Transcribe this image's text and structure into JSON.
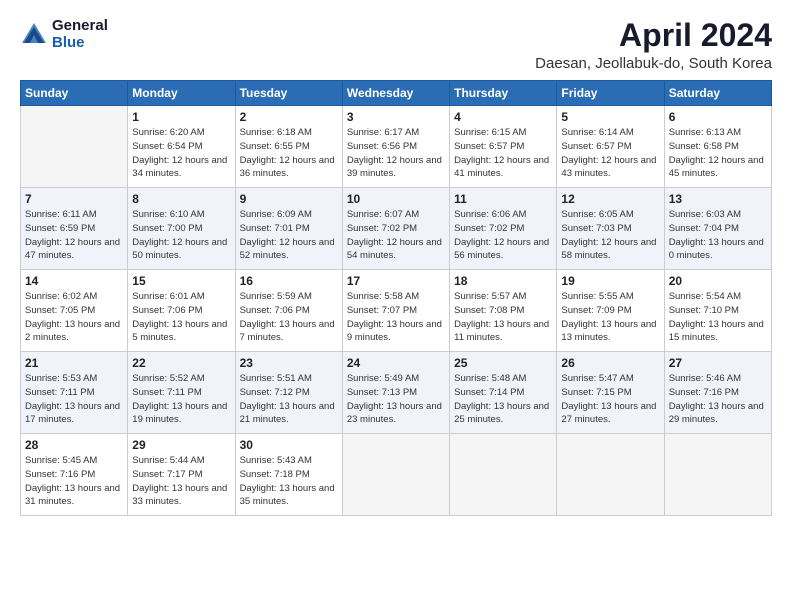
{
  "header": {
    "logo": {
      "general": "General",
      "blue": "Blue"
    },
    "title": "April 2024",
    "location": "Daesan, Jeollabuk-do, South Korea"
  },
  "days_of_week": [
    "Sunday",
    "Monday",
    "Tuesday",
    "Wednesday",
    "Thursday",
    "Friday",
    "Saturday"
  ],
  "weeks": [
    [
      {
        "day": "",
        "sunrise": "",
        "sunset": "",
        "daylight": ""
      },
      {
        "day": "1",
        "sunrise": "Sunrise: 6:20 AM",
        "sunset": "Sunset: 6:54 PM",
        "daylight": "Daylight: 12 hours and 34 minutes."
      },
      {
        "day": "2",
        "sunrise": "Sunrise: 6:18 AM",
        "sunset": "Sunset: 6:55 PM",
        "daylight": "Daylight: 12 hours and 36 minutes."
      },
      {
        "day": "3",
        "sunrise": "Sunrise: 6:17 AM",
        "sunset": "Sunset: 6:56 PM",
        "daylight": "Daylight: 12 hours and 39 minutes."
      },
      {
        "day": "4",
        "sunrise": "Sunrise: 6:15 AM",
        "sunset": "Sunset: 6:57 PM",
        "daylight": "Daylight: 12 hours and 41 minutes."
      },
      {
        "day": "5",
        "sunrise": "Sunrise: 6:14 AM",
        "sunset": "Sunset: 6:57 PM",
        "daylight": "Daylight: 12 hours and 43 minutes."
      },
      {
        "day": "6",
        "sunrise": "Sunrise: 6:13 AM",
        "sunset": "Sunset: 6:58 PM",
        "daylight": "Daylight: 12 hours and 45 minutes."
      }
    ],
    [
      {
        "day": "7",
        "sunrise": "Sunrise: 6:11 AM",
        "sunset": "Sunset: 6:59 PM",
        "daylight": "Daylight: 12 hours and 47 minutes."
      },
      {
        "day": "8",
        "sunrise": "Sunrise: 6:10 AM",
        "sunset": "Sunset: 7:00 PM",
        "daylight": "Daylight: 12 hours and 50 minutes."
      },
      {
        "day": "9",
        "sunrise": "Sunrise: 6:09 AM",
        "sunset": "Sunset: 7:01 PM",
        "daylight": "Daylight: 12 hours and 52 minutes."
      },
      {
        "day": "10",
        "sunrise": "Sunrise: 6:07 AM",
        "sunset": "Sunset: 7:02 PM",
        "daylight": "Daylight: 12 hours and 54 minutes."
      },
      {
        "day": "11",
        "sunrise": "Sunrise: 6:06 AM",
        "sunset": "Sunset: 7:02 PM",
        "daylight": "Daylight: 12 hours and 56 minutes."
      },
      {
        "day": "12",
        "sunrise": "Sunrise: 6:05 AM",
        "sunset": "Sunset: 7:03 PM",
        "daylight": "Daylight: 12 hours and 58 minutes."
      },
      {
        "day": "13",
        "sunrise": "Sunrise: 6:03 AM",
        "sunset": "Sunset: 7:04 PM",
        "daylight": "Daylight: 13 hours and 0 minutes."
      }
    ],
    [
      {
        "day": "14",
        "sunrise": "Sunrise: 6:02 AM",
        "sunset": "Sunset: 7:05 PM",
        "daylight": "Daylight: 13 hours and 2 minutes."
      },
      {
        "day": "15",
        "sunrise": "Sunrise: 6:01 AM",
        "sunset": "Sunset: 7:06 PM",
        "daylight": "Daylight: 13 hours and 5 minutes."
      },
      {
        "day": "16",
        "sunrise": "Sunrise: 5:59 AM",
        "sunset": "Sunset: 7:06 PM",
        "daylight": "Daylight: 13 hours and 7 minutes."
      },
      {
        "day": "17",
        "sunrise": "Sunrise: 5:58 AM",
        "sunset": "Sunset: 7:07 PM",
        "daylight": "Daylight: 13 hours and 9 minutes."
      },
      {
        "day": "18",
        "sunrise": "Sunrise: 5:57 AM",
        "sunset": "Sunset: 7:08 PM",
        "daylight": "Daylight: 13 hours and 11 minutes."
      },
      {
        "day": "19",
        "sunrise": "Sunrise: 5:55 AM",
        "sunset": "Sunset: 7:09 PM",
        "daylight": "Daylight: 13 hours and 13 minutes."
      },
      {
        "day": "20",
        "sunrise": "Sunrise: 5:54 AM",
        "sunset": "Sunset: 7:10 PM",
        "daylight": "Daylight: 13 hours and 15 minutes."
      }
    ],
    [
      {
        "day": "21",
        "sunrise": "Sunrise: 5:53 AM",
        "sunset": "Sunset: 7:11 PM",
        "daylight": "Daylight: 13 hours and 17 minutes."
      },
      {
        "day": "22",
        "sunrise": "Sunrise: 5:52 AM",
        "sunset": "Sunset: 7:11 PM",
        "daylight": "Daylight: 13 hours and 19 minutes."
      },
      {
        "day": "23",
        "sunrise": "Sunrise: 5:51 AM",
        "sunset": "Sunset: 7:12 PM",
        "daylight": "Daylight: 13 hours and 21 minutes."
      },
      {
        "day": "24",
        "sunrise": "Sunrise: 5:49 AM",
        "sunset": "Sunset: 7:13 PM",
        "daylight": "Daylight: 13 hours and 23 minutes."
      },
      {
        "day": "25",
        "sunrise": "Sunrise: 5:48 AM",
        "sunset": "Sunset: 7:14 PM",
        "daylight": "Daylight: 13 hours and 25 minutes."
      },
      {
        "day": "26",
        "sunrise": "Sunrise: 5:47 AM",
        "sunset": "Sunset: 7:15 PM",
        "daylight": "Daylight: 13 hours and 27 minutes."
      },
      {
        "day": "27",
        "sunrise": "Sunrise: 5:46 AM",
        "sunset": "Sunset: 7:16 PM",
        "daylight": "Daylight: 13 hours and 29 minutes."
      }
    ],
    [
      {
        "day": "28",
        "sunrise": "Sunrise: 5:45 AM",
        "sunset": "Sunset: 7:16 PM",
        "daylight": "Daylight: 13 hours and 31 minutes."
      },
      {
        "day": "29",
        "sunrise": "Sunrise: 5:44 AM",
        "sunset": "Sunset: 7:17 PM",
        "daylight": "Daylight: 13 hours and 33 minutes."
      },
      {
        "day": "30",
        "sunrise": "Sunrise: 5:43 AM",
        "sunset": "Sunset: 7:18 PM",
        "daylight": "Daylight: 13 hours and 35 minutes."
      },
      {
        "day": "",
        "sunrise": "",
        "sunset": "",
        "daylight": ""
      },
      {
        "day": "",
        "sunrise": "",
        "sunset": "",
        "daylight": ""
      },
      {
        "day": "",
        "sunrise": "",
        "sunset": "",
        "daylight": ""
      },
      {
        "day": "",
        "sunrise": "",
        "sunset": "",
        "daylight": ""
      }
    ]
  ]
}
